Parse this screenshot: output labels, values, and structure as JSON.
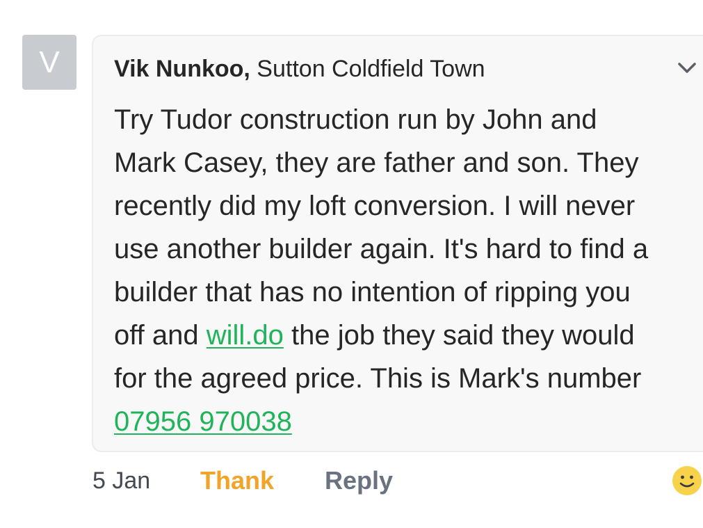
{
  "comment": {
    "avatar_letter": "V",
    "author": "Vik Nunkoo,",
    "location": " Sutton Coldfield Town",
    "body": {
      "line1": "Try Tudor construction run by John and",
      "line2": "Mark Casey, they are father and son. They",
      "line3": "recently did my loft conversion. I will never",
      "line4": "use another builder again. It's hard to find a",
      "line5": "builder that has no intention of ripping you",
      "line6_pre": "off and ",
      "line6_link": "will.do",
      "line6_post": " the job they said they would",
      "line7": "for the agreed price. This is Mark's number",
      "phone_link": "07956 970038"
    },
    "menu_icon": "chevron-down-icon"
  },
  "footer": {
    "date": "5 Jan",
    "thank_label": "Thank",
    "reply_label": "Reply",
    "reaction_icon": "smiley-icon"
  },
  "colors": {
    "link": "#1fb45a",
    "thank": "#f0a42a",
    "reply": "#6a7280",
    "avatar_bg": "#c8cbd0",
    "emoji": "#f7d24a"
  }
}
